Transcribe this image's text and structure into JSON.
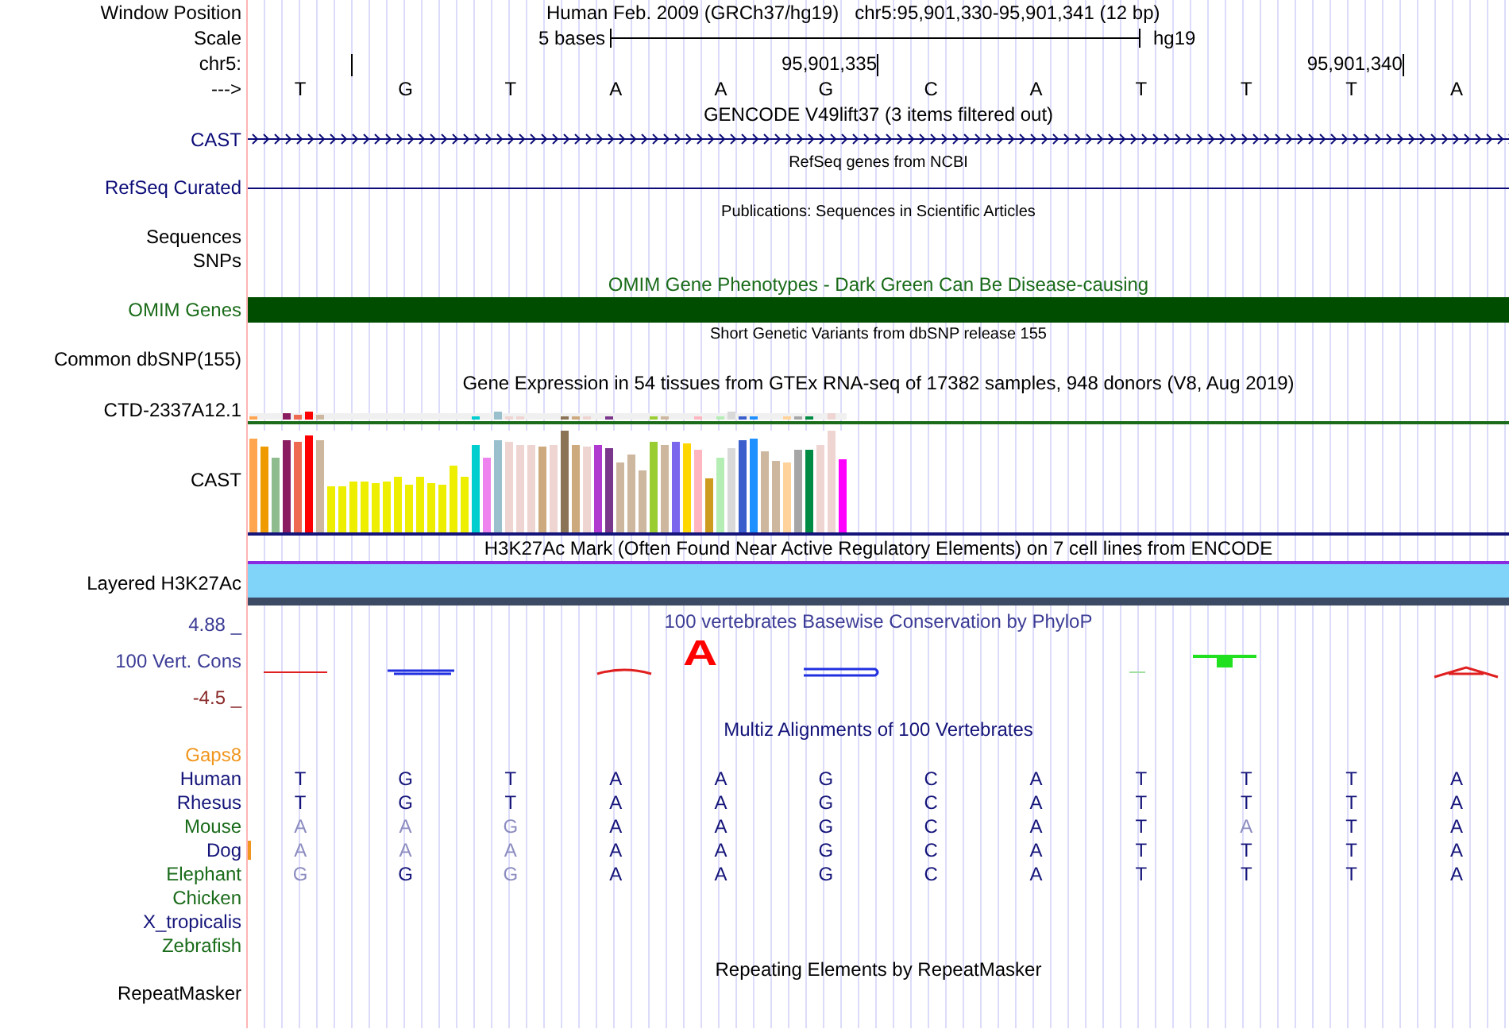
{
  "header": {
    "window_label": "Window Position",
    "assembly": "Human Feb. 2009 (GRCh37/hg19)",
    "position": "chr5:95,901,330-95,901,341 (12 bp)",
    "scale_label": "Scale",
    "scale_text": "5 bases",
    "scale_db": "hg19",
    "chrom_label": "chr5:",
    "ticks": [
      "95,901,335",
      "95,901,340"
    ],
    "strand_label": "--->",
    "bases": [
      "T",
      "G",
      "T",
      "A",
      "A",
      "G",
      "C",
      "A",
      "T",
      "T",
      "T",
      "A"
    ]
  },
  "tracks": [
    {
      "kind": "title",
      "text": "GENCODE V49lift37 (3 items filtered out)",
      "color": "#000000"
    },
    {
      "kind": "gene_arrows",
      "label": "CAST",
      "color": "#0c0c78"
    },
    {
      "kind": "title_small",
      "text": "RefSeq genes from NCBI",
      "color": "#000000"
    },
    {
      "kind": "gene_line",
      "label": "RefSeq Curated",
      "color": "#0c0c78"
    },
    {
      "kind": "title_small",
      "text": "Publications: Sequences in Scientific Articles",
      "color": "#000000"
    },
    {
      "kind": "empty",
      "label": "Sequences",
      "color": "#000000"
    },
    {
      "kind": "empty",
      "label": "SNPs",
      "color": "#000000"
    },
    {
      "kind": "title",
      "text": "OMIM Gene Phenotypes - Dark Green Can Be Disease-causing",
      "color": "#1a6b1a"
    },
    {
      "kind": "omim_bar",
      "label": "OMIM Genes",
      "color": "#1a6b1a"
    },
    {
      "kind": "title_small",
      "text": "Short Genetic Variants from dbSNP release 155",
      "color": "#000000"
    },
    {
      "kind": "empty",
      "label": "Common dbSNP(155)",
      "color": "#000000"
    },
    {
      "kind": "title",
      "text": "Gene Expression in 54 tissues from GTEx RNA-seq of 17382 samples, 948 donors (V8, Aug 2019)",
      "color": "#000000"
    },
    {
      "kind": "gtex_mini",
      "label": "CTD-2337A12.1",
      "color": "#000000"
    },
    {
      "kind": "gtex_bars",
      "label": "CAST",
      "color": "#000000"
    },
    {
      "kind": "title",
      "text": "H3K27Ac Mark (Often Found Near Active Regulatory Elements) on 7 cell lines from ENCODE",
      "color": "#000000"
    },
    {
      "kind": "h3k27ac",
      "label": "Layered H3K27Ac",
      "color": "#000000"
    },
    {
      "kind": "conservation",
      "title": "100 vertebrates Basewise Conservation by PhyloP",
      "label": "100 Vert. Cons",
      "max": "4.88 _",
      "min": "-4.5 _",
      "logo_letter": "A",
      "color": "#3c3c96"
    },
    {
      "kind": "title",
      "text": "Multiz Alignments of 100 Vertebrates",
      "color": "#14147a"
    }
  ],
  "alignment": {
    "gaps_label": "Gaps8",
    "species": [
      {
        "name": "Human",
        "color": "#14147a",
        "gap": false,
        "bases": [
          {
            "letter": "T",
            "match": true
          },
          {
            "letter": "G",
            "match": true
          },
          {
            "letter": "T",
            "match": true
          },
          {
            "letter": "A",
            "match": true
          },
          {
            "letter": "A",
            "match": true
          },
          {
            "letter": "G",
            "match": true
          },
          {
            "letter": "C",
            "match": true
          },
          {
            "letter": "A",
            "match": true
          },
          {
            "letter": "T",
            "match": true
          },
          {
            "letter": "T",
            "match": true
          },
          {
            "letter": "T",
            "match": true
          },
          {
            "letter": "A",
            "match": true
          }
        ]
      },
      {
        "name": "Rhesus",
        "color": "#14147a",
        "gap": false,
        "bases": [
          {
            "letter": "T",
            "match": true
          },
          {
            "letter": "G",
            "match": true
          },
          {
            "letter": "T",
            "match": true
          },
          {
            "letter": "A",
            "match": true
          },
          {
            "letter": "A",
            "match": true
          },
          {
            "letter": "G",
            "match": true
          },
          {
            "letter": "C",
            "match": true
          },
          {
            "letter": "A",
            "match": true
          },
          {
            "letter": "T",
            "match": true
          },
          {
            "letter": "T",
            "match": true
          },
          {
            "letter": "T",
            "match": true
          },
          {
            "letter": "A",
            "match": true
          }
        ]
      },
      {
        "name": "Mouse",
        "color": "#1a6b1a",
        "gap": false,
        "bases": [
          {
            "letter": "A",
            "match": false
          },
          {
            "letter": "A",
            "match": false
          },
          {
            "letter": "G",
            "match": false
          },
          {
            "letter": "A",
            "match": true
          },
          {
            "letter": "A",
            "match": true
          },
          {
            "letter": "G",
            "match": true
          },
          {
            "letter": "C",
            "match": true
          },
          {
            "letter": "A",
            "match": true
          },
          {
            "letter": "T",
            "match": true
          },
          {
            "letter": "A",
            "match": false
          },
          {
            "letter": "T",
            "match": true
          },
          {
            "letter": "A",
            "match": true
          }
        ]
      },
      {
        "name": "Dog",
        "color": "#14147a",
        "gap": true,
        "bases": [
          {
            "letter": "A",
            "match": false
          },
          {
            "letter": "A",
            "match": false
          },
          {
            "letter": "A",
            "match": false
          },
          {
            "letter": "A",
            "match": true
          },
          {
            "letter": "A",
            "match": true
          },
          {
            "letter": "G",
            "match": true
          },
          {
            "letter": "C",
            "match": true
          },
          {
            "letter": "A",
            "match": true
          },
          {
            "letter": "T",
            "match": true
          },
          {
            "letter": "T",
            "match": true
          },
          {
            "letter": "T",
            "match": true
          },
          {
            "letter": "A",
            "match": true
          }
        ]
      },
      {
        "name": "Elephant",
        "color": "#1a6b1a",
        "gap": false,
        "bases": [
          {
            "letter": "G",
            "match": false
          },
          {
            "letter": "G",
            "match": true
          },
          {
            "letter": "G",
            "match": false
          },
          {
            "letter": "A",
            "match": true
          },
          {
            "letter": "A",
            "match": true
          },
          {
            "letter": "G",
            "match": true
          },
          {
            "letter": "C",
            "match": true
          },
          {
            "letter": "A",
            "match": true
          },
          {
            "letter": "T",
            "match": true
          },
          {
            "letter": "T",
            "match": true
          },
          {
            "letter": "T",
            "match": true
          },
          {
            "letter": "A",
            "match": true
          }
        ]
      },
      {
        "name": "Chicken",
        "color": "#1a6b1a",
        "gap": false
      },
      {
        "name": "X_tropicalis",
        "color": "#14147a",
        "gap": false
      },
      {
        "name": "Zebrafish",
        "color": "#1a6b1a",
        "gap": false
      }
    ]
  },
  "repeats": {
    "title": "Repeating Elements by RepeatMasker",
    "label": "RepeatMasker"
  }
}
